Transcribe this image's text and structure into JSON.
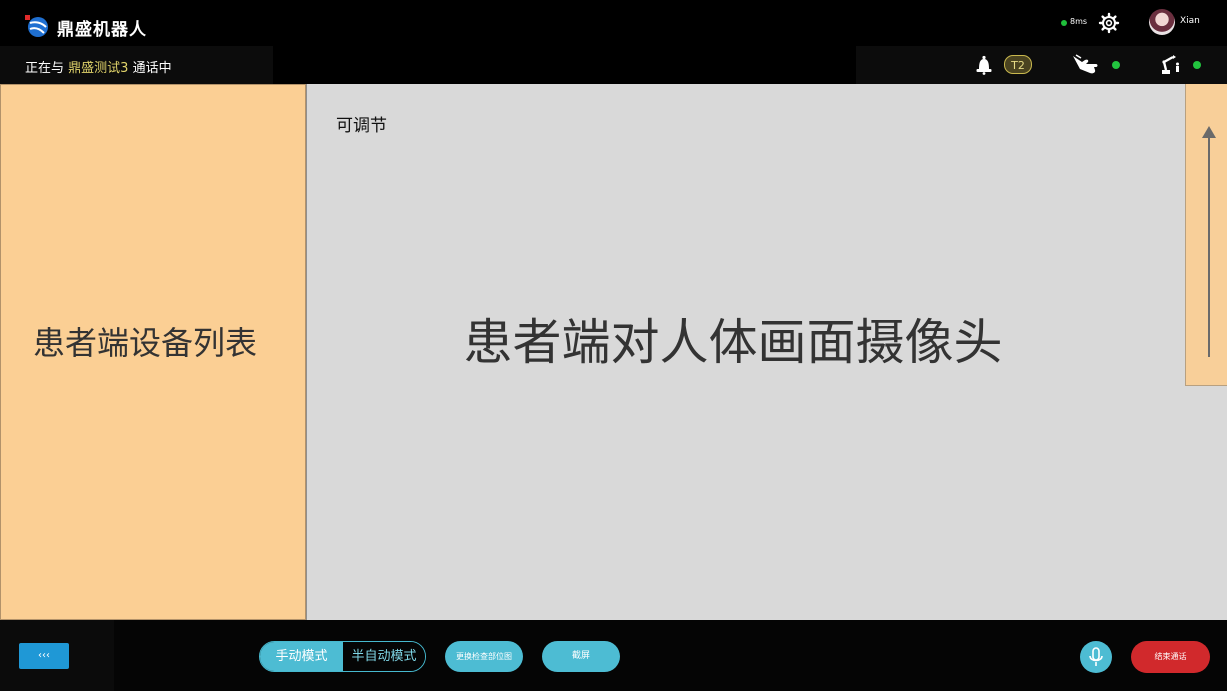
{
  "header": {
    "app_title": "鼎盛机器人",
    "latency": "8ms",
    "username": "Xian"
  },
  "status": {
    "prefix": "正在与",
    "peer": "鼎盛测试3",
    "suffix": "通话中",
    "badge": "T2"
  },
  "panels": {
    "device_list_label": "患者端设备列表",
    "adjust_label": "可调节",
    "camera_label": "患者端对人体画面摄像头"
  },
  "toolbar": {
    "collapse_label": "‹‹‹",
    "mode_manual": "手动模式",
    "mode_semi": "半自动模式",
    "switch_view": "更换检查部位图",
    "screenshot": "截屏",
    "end_call": "结束通话"
  },
  "colors": {
    "accent": "#4dbcd3",
    "danger": "#d1292c",
    "online": "#22c43f",
    "panel": "#fbcf94"
  }
}
